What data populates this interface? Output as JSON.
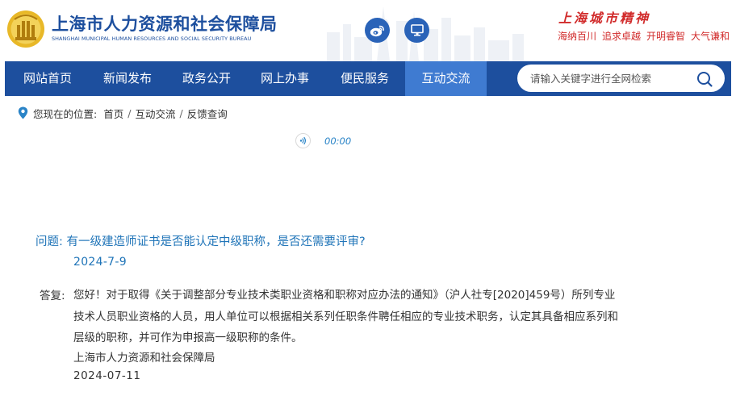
{
  "header": {
    "title": "上海市人力资源和社会保障局",
    "subtitle": "SHANGHAI MUNICIPAL HUMAN RESOURCES AND SOCIAL SECURITY BUREAU",
    "spirit_title": "上海城市精神",
    "spirit_items": [
      "海纳百川",
      "追求卓越",
      "开明睿智",
      "大气谦和"
    ],
    "brand_color": "#1d4f9e",
    "accent_red": "#d12b2b",
    "social_icons": [
      "weibo-icon",
      "monitor-icon"
    ]
  },
  "nav": {
    "items": [
      {
        "label": "网站首页",
        "active": false
      },
      {
        "label": "新闻发布",
        "active": false
      },
      {
        "label": "政务公开",
        "active": false
      },
      {
        "label": "网上办事",
        "active": false
      },
      {
        "label": "便民服务",
        "active": false
      },
      {
        "label": "互动交流",
        "active": true
      }
    ],
    "search_placeholder": "请输入关键字进行全网检索",
    "active_color": "#3f7bd1"
  },
  "breadcrumb": {
    "prefix": "您现在的位置:",
    "items": [
      "首页",
      "互动交流",
      "反馈查询"
    ]
  },
  "audio": {
    "time": "00:00"
  },
  "qa": {
    "question_label": "问题:",
    "question_text": "有一级建造师证书是否能认定中级职称，是否还需要评审?",
    "question_date": "2024-7-9",
    "answer_label": "答复:",
    "answer_lines": [
      "您好！对于取得《关于调整部分专业技术类职业资格和职称对应办法的通知》（沪人社专[2020]459号）所列专业",
      "技术人员职业资格的人员，用人单位可以根据相关系列任职条件聘任相应的专业技术职务，认定其具备相应系列和",
      "层级的职称，并可作为申报高一级职称的条件。"
    ],
    "answer_org": "上海市人力资源和社会保障局",
    "answer_date": "2024-07-11",
    "question_color": "#1f74b8"
  }
}
